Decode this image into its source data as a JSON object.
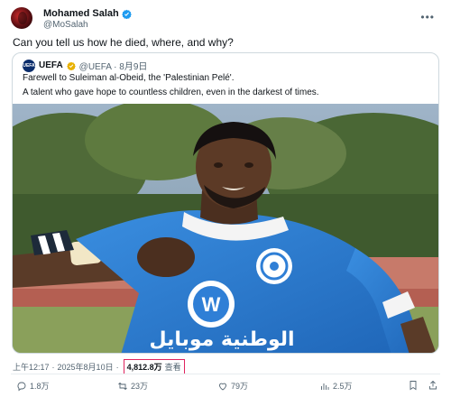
{
  "author": {
    "name": "Mohamed Salah",
    "handle": "@MoSalah"
  },
  "tweet": {
    "text": "Can you tell us how he died, where, and why?"
  },
  "quote": {
    "avatar_text": "UEFA",
    "name": "UEFA",
    "handle_date": "@UEFA · 8月9日",
    "line1": "Farewell to Suleiman al-Obeid, the 'Palestinian Pelé'.",
    "line2": "A talent who gave hope to countless children, even in the darkest of times.",
    "image": {
      "jersey_text": "الوطنية موبايل",
      "sponsor_logo": "W"
    }
  },
  "meta": {
    "time": "上午12:17",
    "date": "2025年8月10日",
    "views_count": "4,812.8万",
    "views_label": "查看"
  },
  "actions": {
    "replies": "1.8万",
    "retweets": "23万",
    "likes": "79万",
    "views": "2.5万"
  },
  "colors": {
    "verified": "#1d9bf0",
    "highlight_border": "#e0245e",
    "jersey_blue": "#2f7fd6"
  },
  "icons": [
    "verified-badge-icon",
    "more-icon",
    "reply-icon",
    "retweet-icon",
    "like-icon",
    "views-icon",
    "bookmark-icon",
    "share-icon"
  ]
}
